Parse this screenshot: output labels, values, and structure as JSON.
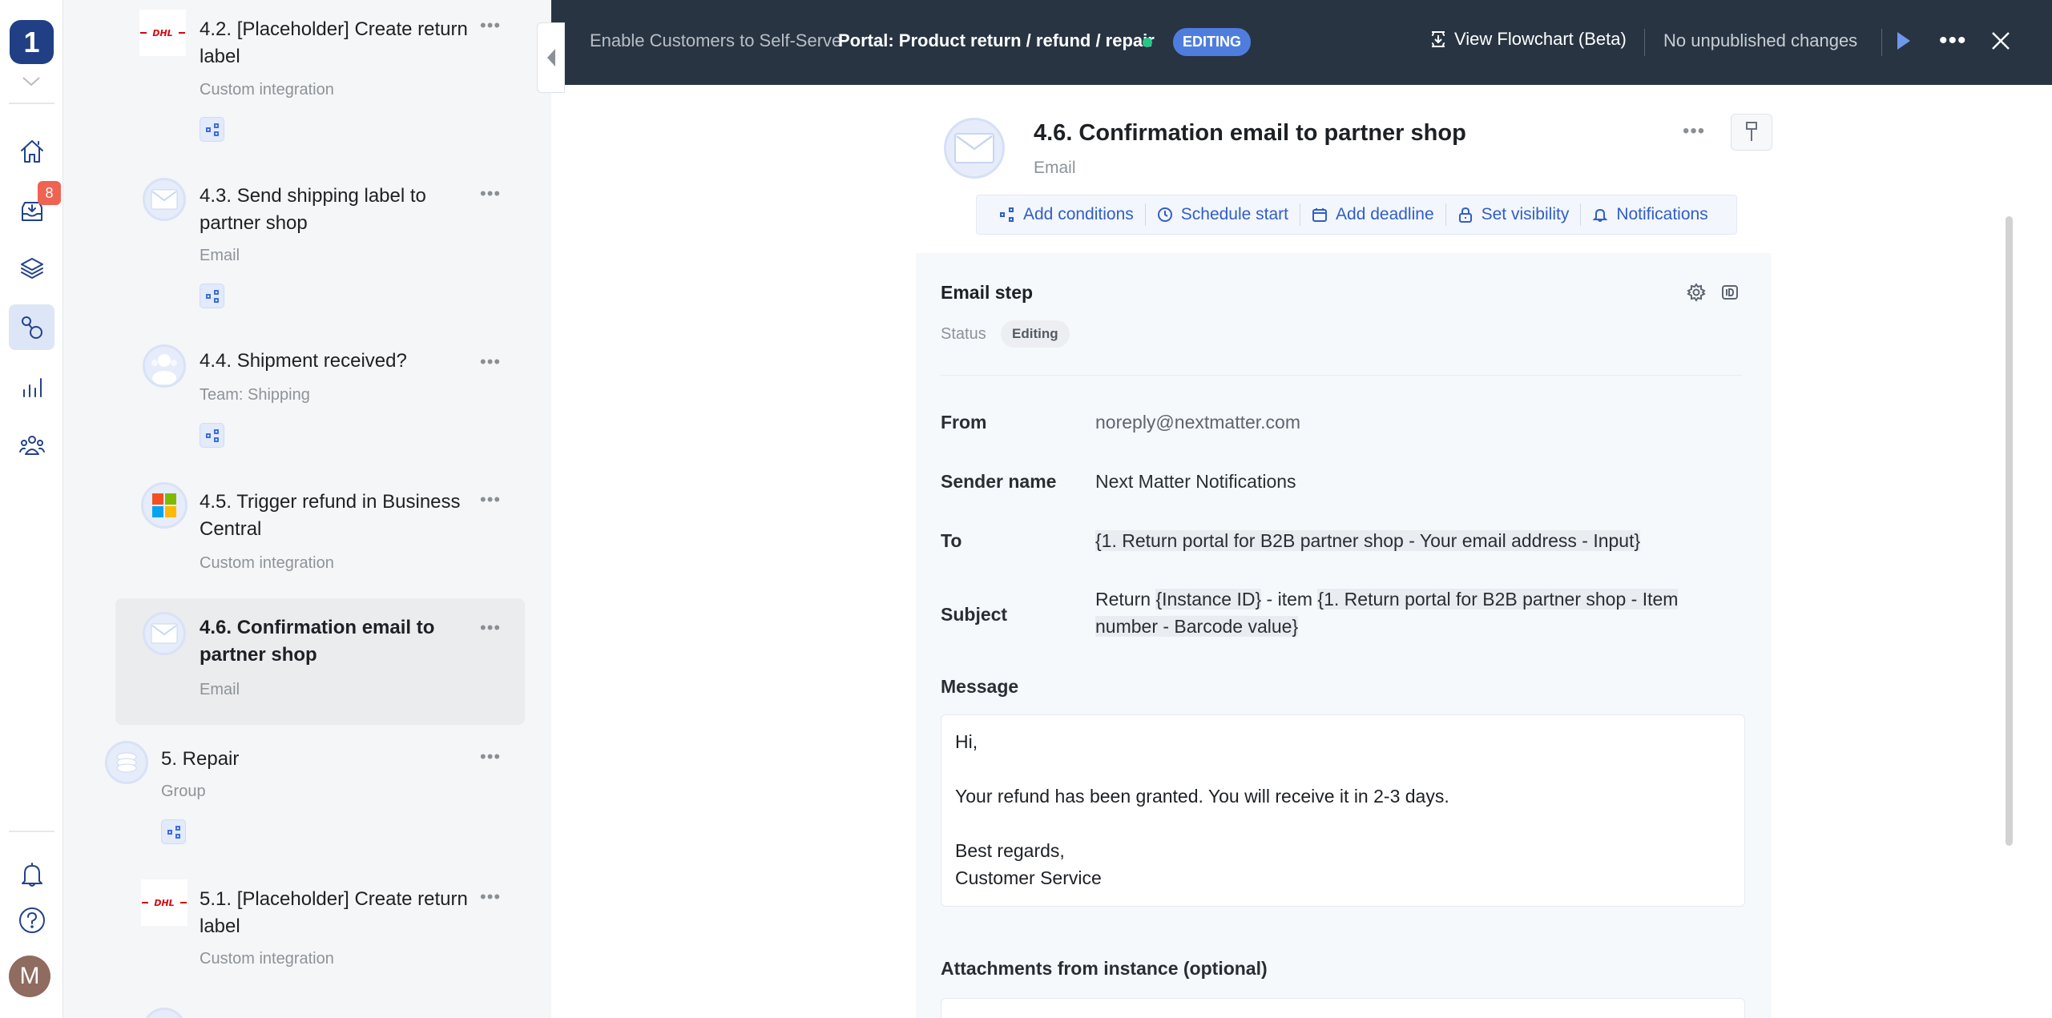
{
  "rail": {
    "logo_text": "1",
    "inbox_badge": "8",
    "avatar_initial": "M",
    "items": [
      {
        "name": "home",
        "icon": "home-icon"
      },
      {
        "name": "inbox",
        "icon": "inbox-icon"
      },
      {
        "name": "layers",
        "icon": "layers-icon"
      },
      {
        "name": "processes",
        "icon": "process-icon",
        "active": true
      },
      {
        "name": "reports",
        "icon": "bar-chart-icon"
      },
      {
        "name": "teams",
        "icon": "users-icon"
      }
    ],
    "bottom": [
      {
        "name": "notifications",
        "icon": "bell-icon"
      },
      {
        "name": "help",
        "icon": "help-icon"
      }
    ]
  },
  "steps": [
    {
      "title": "4.2. [Placeholder] Create return label",
      "type": "Custom integration",
      "icon": "dhl-logo",
      "has_conditions": true
    },
    {
      "title": "4.3. Send shipping label to partner shop",
      "type": "Email",
      "icon": "email-icon",
      "has_conditions": true
    },
    {
      "title": "4.4. Shipment received?",
      "type": "Team: Shipping",
      "icon": "team-icon",
      "has_conditions": true
    },
    {
      "title": "4.5. Trigger refund in Business Central",
      "type": "Custom integration",
      "icon": "microsoft-logo",
      "has_conditions": false
    },
    {
      "title": "4.6. Confirmation email to partner shop",
      "type": "Email",
      "icon": "email-icon",
      "selected": true,
      "has_conditions": false
    },
    {
      "title": "5. Repair",
      "type": "Group",
      "icon": "group-icon",
      "has_conditions": true
    },
    {
      "title": "5.1. [Placeholder] Create return label",
      "type": "Custom integration",
      "icon": "dhl-logo",
      "has_conditions": false
    }
  ],
  "topbar": {
    "breadcrumb": "Enable Customers to Self-Serve",
    "process_title": "Portal: Product return / refund / repair",
    "status_pill": "EDITING",
    "view_flowchart": "View Flowchart (Beta)",
    "publish_status": "No unpublished changes"
  },
  "step_header": {
    "title": "4.6. Confirmation email to partner shop",
    "type": "Email"
  },
  "actions": [
    {
      "label": "Add conditions",
      "icon": "conditions-icon"
    },
    {
      "label": "Schedule start",
      "icon": "clock-icon"
    },
    {
      "label": "Add deadline",
      "icon": "calendar-icon"
    },
    {
      "label": "Set visibility",
      "icon": "lock-icon"
    },
    {
      "label": "Notifications",
      "icon": "bell-icon"
    }
  ],
  "email_step": {
    "title": "Email step",
    "status_label": "Status",
    "status_value": "Editing",
    "fields": {
      "from_label": "From",
      "from_value": "noreply@nextmatter.com",
      "sender_label": "Sender name",
      "sender_value": "Next Matter Notifications",
      "to_label": "To",
      "to_value": "{1. Return portal for B2B partner shop - Your email address - Input}",
      "subject_label": "Subject",
      "subject_prefix": "Return ",
      "subject_token1": "{Instance ID}",
      "subject_mid": " - item ",
      "subject_token2": "{1. Return portal for B2B partner shop - Item number - Barcode value}"
    },
    "message_label": "Message",
    "message_lines": [
      "Hi,",
      "",
      "Your refund has been granted. You will receive it in 2-3 days.",
      "",
      "Best regards,",
      "Customer Service"
    ],
    "attachments_label": "Attachments from instance (optional)"
  },
  "colors": {
    "topbar_bg": "#283442",
    "accent": "#2f5fc6",
    "editing_pill": "#4f7ddd",
    "live_dot": "#26c689",
    "badge": "#ef6352",
    "brand": "#213f84"
  }
}
